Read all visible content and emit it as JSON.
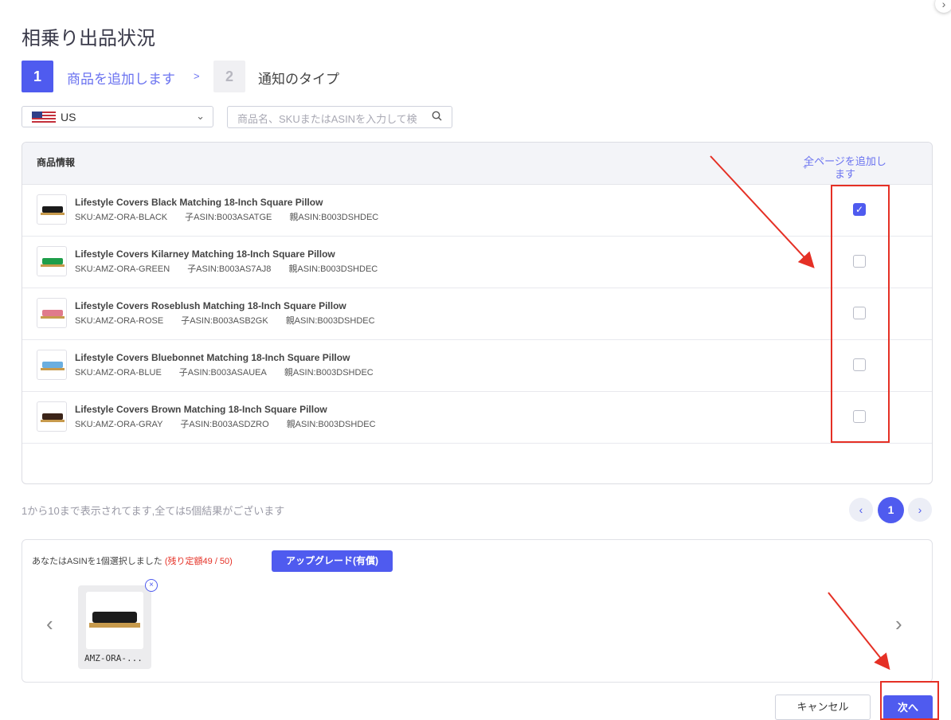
{
  "title": "相乗り出品状況",
  "steps": [
    {
      "num": "1",
      "label": "商品を追加します"
    },
    {
      "num": "2",
      "label": "通知のタイプ"
    }
  ],
  "step_separator": ">",
  "marketplace": {
    "value": "US"
  },
  "search": {
    "placeholder": "商品名、SKUまたはASINを入力して検"
  },
  "table": {
    "header_label": "商品情報",
    "add_all_label": "全ページを追加します",
    "rows": [
      {
        "name": "Lifestyle Covers Black Matching 18-Inch Square Pillow",
        "sku": "SKU:AMZ-ORA-BLACK",
        "child_asin": "子ASIN:B003ASATGE",
        "parent_asin": "親ASIN:B003DSHDEC",
        "checked": true,
        "color": "#1a1a1a"
      },
      {
        "name": "Lifestyle Covers Kilarney Matching 18-Inch Square Pillow",
        "sku": "SKU:AMZ-ORA-GREEN",
        "child_asin": "子ASIN:B003AS7AJ8",
        "parent_asin": "親ASIN:B003DSHDEC",
        "checked": false,
        "color": "#1e9e4a"
      },
      {
        "name": "Lifestyle Covers Roseblush Matching 18-Inch Square Pillow",
        "sku": "SKU:AMZ-ORA-ROSE",
        "child_asin": "子ASIN:B003ASB2GK",
        "parent_asin": "親ASIN:B003DSHDEC",
        "checked": false,
        "color": "#e07a8c"
      },
      {
        "name": "Lifestyle Covers Bluebonnet Matching 18-Inch Square Pillow",
        "sku": "SKU:AMZ-ORA-BLUE",
        "child_asin": "子ASIN:B003ASAUEA",
        "parent_asin": "親ASIN:B003DSHDEC",
        "checked": false,
        "color": "#6aaee0"
      },
      {
        "name": "Lifestyle Covers Brown Matching 18-Inch Square Pillow",
        "sku": "SKU:AMZ-ORA-GRAY",
        "child_asin": "子ASIN:B003ASDZRO",
        "parent_asin": "親ASIN:B003DSHDEC",
        "checked": false,
        "color": "#3b2418"
      }
    ]
  },
  "pagination": {
    "summary": "1から10まで表示されてます,全ては5個結果がございます",
    "current_page": "1"
  },
  "selection": {
    "text": "あなたはASINを1個選択しました",
    "quota": "(残り定額49 / 50)",
    "upgrade_label": "アップグレード(有償)",
    "items": [
      {
        "label": "AMZ-ORA-..."
      }
    ]
  },
  "actions": {
    "cancel_label": "キャンセル",
    "next_label": "次へ"
  },
  "colors": {
    "accent": "#4f5bef",
    "annotation_red": "#e53025"
  }
}
